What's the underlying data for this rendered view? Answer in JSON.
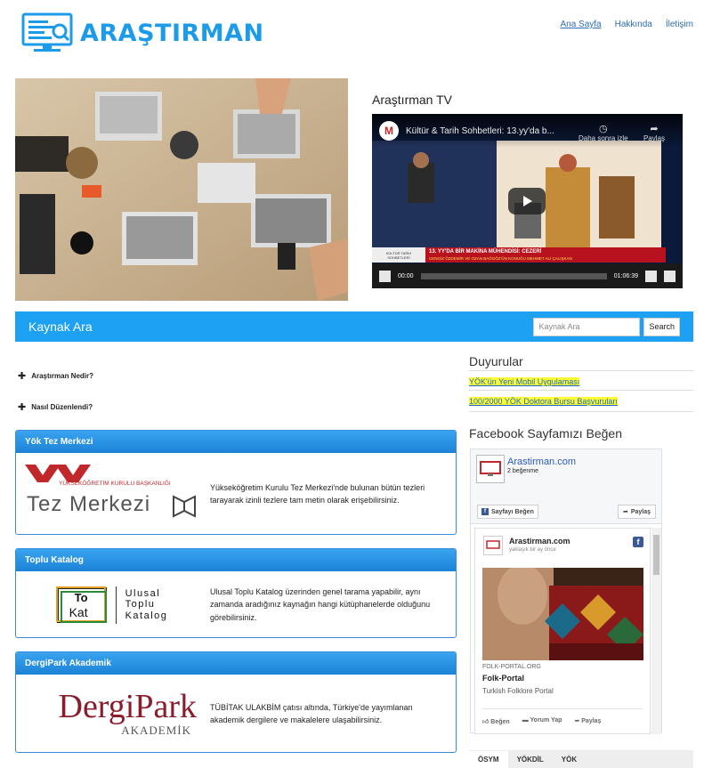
{
  "site": {
    "name": "ARAŞTIRMAN",
    "brand_color": "#1e9be8"
  },
  "nav": [
    {
      "label": "Ana Sayfa",
      "active": true
    },
    {
      "label": "Hakkında",
      "active": false
    },
    {
      "label": "İletişim",
      "active": false
    }
  ],
  "tv": {
    "title": "Araştırman TV",
    "channel_initial": "M",
    "video_title": "Kültür & Tarih Sohbetleri: 13.yy'da b...",
    "watch_later": "Daha sonra izle",
    "share": "Paylaş",
    "current_time": "00:00",
    "duration": "01:06:39",
    "banner": "13. YY'DA BİR MAKİNA MÜHENDİSİ: CEZERİ",
    "subbanner": "CENGİZ ÖZDEMİR VE OZAN BAĞGÖZ'ÜN KONUĞU MEHMET ALİ ÇALIŞKAN",
    "show_label": "KÜLTÜR TARİH SOHBETLERİ"
  },
  "search": {
    "title": "Kaynak Ara",
    "placeholder": "Kaynak Ara",
    "button": "Search"
  },
  "accordion": [
    {
      "label": "Araştırman Nedir?"
    },
    {
      "label": "Nasıl Düzenlendi?"
    }
  ],
  "boxes": [
    {
      "title": "Yök Tez Merkezi",
      "logo_top": "YÜKSEKÖĞRETİM KURULU BAŞKANLIĞI",
      "logo_main": "Tez Merkezi",
      "text": "Yükseköğretim Kurulu Tez Merkezi'nde bulunan bütün tezleri tarayarak izinli tezlere tam metin olarak erişebilirsiniz."
    },
    {
      "title": "Toplu Katalog",
      "logo_mark_1": "To",
      "logo_mark_2": "Kat",
      "logo_line_1": "Ulusal",
      "logo_line_2": "Toplu",
      "logo_line_3": "Katalog",
      "text": "Ulusal Toplu Katalog üzerinden genel tarama yapabilir, aynı zamanda aradığınız kaynağın hangi kütüphanelerde olduğunu görebilirsiniz."
    },
    {
      "title": "DergiPark Akademik",
      "logo_main": "DergiPark",
      "logo_sub": "AKADEMİK",
      "text": "TÜBİTAK ULAKBİM çatısı altında, Türkiye'de yayımlanan akademik dergilere ve makalelere ulaşabilirsiniz."
    }
  ],
  "announcements": {
    "title": "Duyurular",
    "items": [
      "YÖK'ün Yeni Mobil Uygulaması",
      "100/2000 YÖK Doktora Bursu Başvuruları"
    ]
  },
  "facebook": {
    "title": "Facebook Sayfamızı Beğen",
    "page_name": "Arastirman.com",
    "likes": "2 beğenme",
    "like_button": "Sayfayı Beğen",
    "share_button": "Paylaş",
    "post": {
      "author": "Arastirman.com",
      "time": "yaklaşık bir ay önce",
      "link_source": "FOLK-PORTAL.ORG",
      "link_title": "Folk-Portal",
      "link_desc": "Turkish Folklore Portal",
      "actions": [
        "Beğen",
        "Yorum Yap",
        "Paylaş"
      ]
    }
  },
  "tabs": [
    {
      "label": "ÖSYM",
      "active": true
    },
    {
      "label": "YÖKDİL",
      "active": false
    },
    {
      "label": "YÖK",
      "active": false
    }
  ]
}
